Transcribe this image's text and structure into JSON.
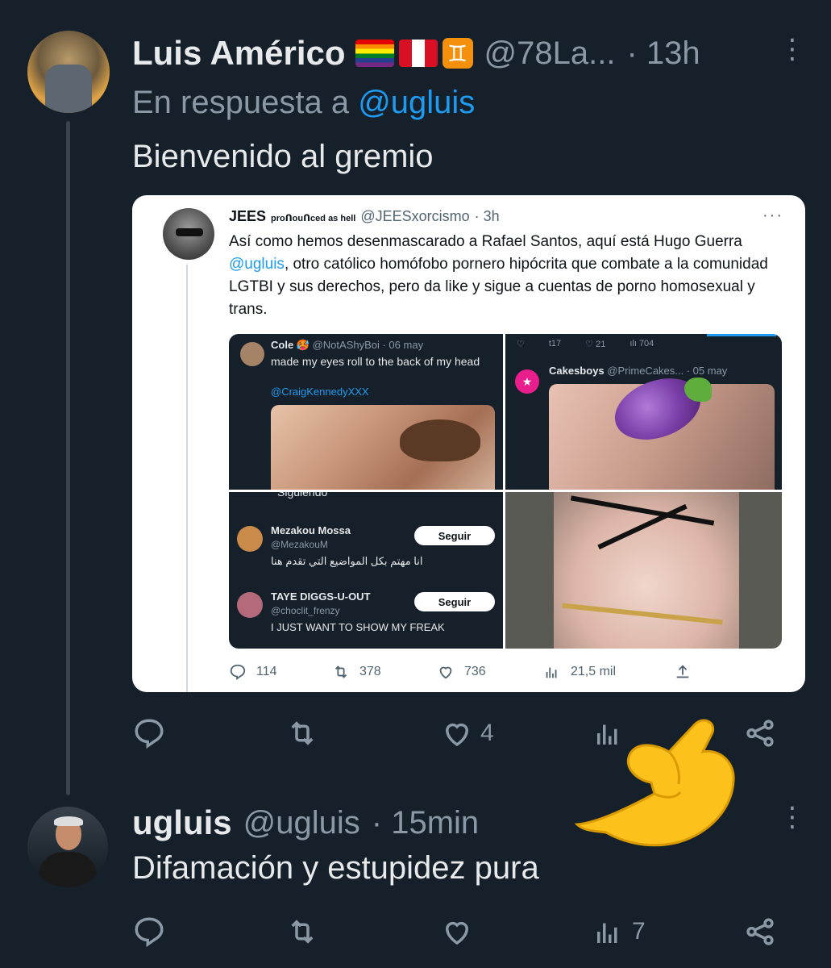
{
  "tweet1": {
    "name": "Luis Américo",
    "flags": [
      "rainbow-flag-emoji",
      "peru-flag-emoji",
      "gemini-emoji"
    ],
    "gemini_symbol": "♊",
    "handle": "@78La...",
    "time": "· 13h",
    "reply_prefix": "En respuesta a ",
    "reply_mention": "@ugluis",
    "text": "Bienvenido al gremio",
    "actions": {
      "reply": "",
      "retweet": "",
      "like": "4",
      "views": "",
      "share": ""
    }
  },
  "embedded": {
    "name": "JEES",
    "tag": "proᑎouᑎced as hell",
    "handle": "@JEESxorcismo",
    "time": "· 3h",
    "more": "···",
    "text_1": "Así como hemos desenmascarado a Rafael Santos, aquí está Hugo Guerra ",
    "text_mention": "@ugluis",
    "text_2": ", otro católico homófobo pornero hipócrita que combate a la comunidad LGTBI y sus derechos, pero da like y sigue a cuentas de porno homosexual y trans.",
    "q1": {
      "name": "Cole",
      "handle": "@NotAShyBoi · 06 may",
      "text": "made my eyes roll to the back of my head",
      "mention": "@CraigKennedyXXX"
    },
    "q2": {
      "icons": [
        "♡",
        "t17",
        "♡ 21",
        "ılı 704"
      ],
      "name": "Cakesboys",
      "handle": "@PrimeCakes... · 05 may"
    },
    "q3": {
      "top": "Siguiendo",
      "rows": [
        {
          "name": "Mezakou Mossa",
          "handle": "@MezakouM",
          "bio": "انا مهتم بكل المواضيع التي تقدم هنا",
          "button": "Seguir"
        },
        {
          "name": "TAYE DIGGS-U-OUT",
          "handle": "@choclit_frenzy",
          "bio": "I JUST WANT TO SHOW MY FREAK",
          "button": "Seguir"
        }
      ]
    },
    "actions": {
      "reply": "114",
      "retweet": "378",
      "like": "736",
      "views": "21,5 mil"
    }
  },
  "tweet2": {
    "name": "ugluis",
    "handle": "@ugluis",
    "time": "· 15min",
    "text": "Difamación y estupidez pura",
    "actions": {
      "reply": "",
      "retweet": "",
      "like": "",
      "views": "7",
      "share": ""
    }
  },
  "kebab": "⋮",
  "colors": {
    "background": "#15202b",
    "accent": "#1d9bf0",
    "muted": "#8b98a5",
    "text": "#e7e9ea"
  }
}
